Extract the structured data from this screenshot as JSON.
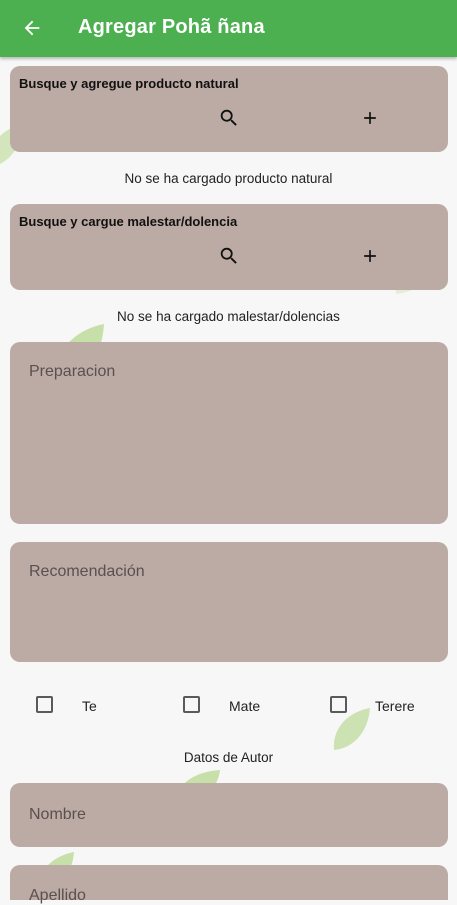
{
  "appbar": {
    "title": "Agregar Pohã ñana",
    "back_icon": "arrow-left-icon",
    "color": "#4caf50"
  },
  "natural_product": {
    "title": "Busque y agregue producto natural",
    "search_icon": "search-icon",
    "add_icon": "plus-icon",
    "empty_text": "No se ha cargado producto natural"
  },
  "ailment": {
    "title": "Busque y cargue malestar/dolencia",
    "search_icon": "search-icon",
    "add_icon": "plus-icon",
    "empty_text": "No se ha cargado malestar/dolencias"
  },
  "form": {
    "preparacion_placeholder": "Preparacion",
    "recomendacion_placeholder": "Recomendación",
    "options": [
      {
        "label": "Te",
        "checked": false
      },
      {
        "label": "Mate",
        "checked": false
      },
      {
        "label": "Terere",
        "checked": false
      }
    ],
    "author_section": "Datos de Autor",
    "nombre_placeholder": "Nombre",
    "apellido_placeholder": "Apellido"
  },
  "colors": {
    "card": "#bcaaa4",
    "background": "#f7f7f7",
    "leaf": "#8bc34a"
  }
}
